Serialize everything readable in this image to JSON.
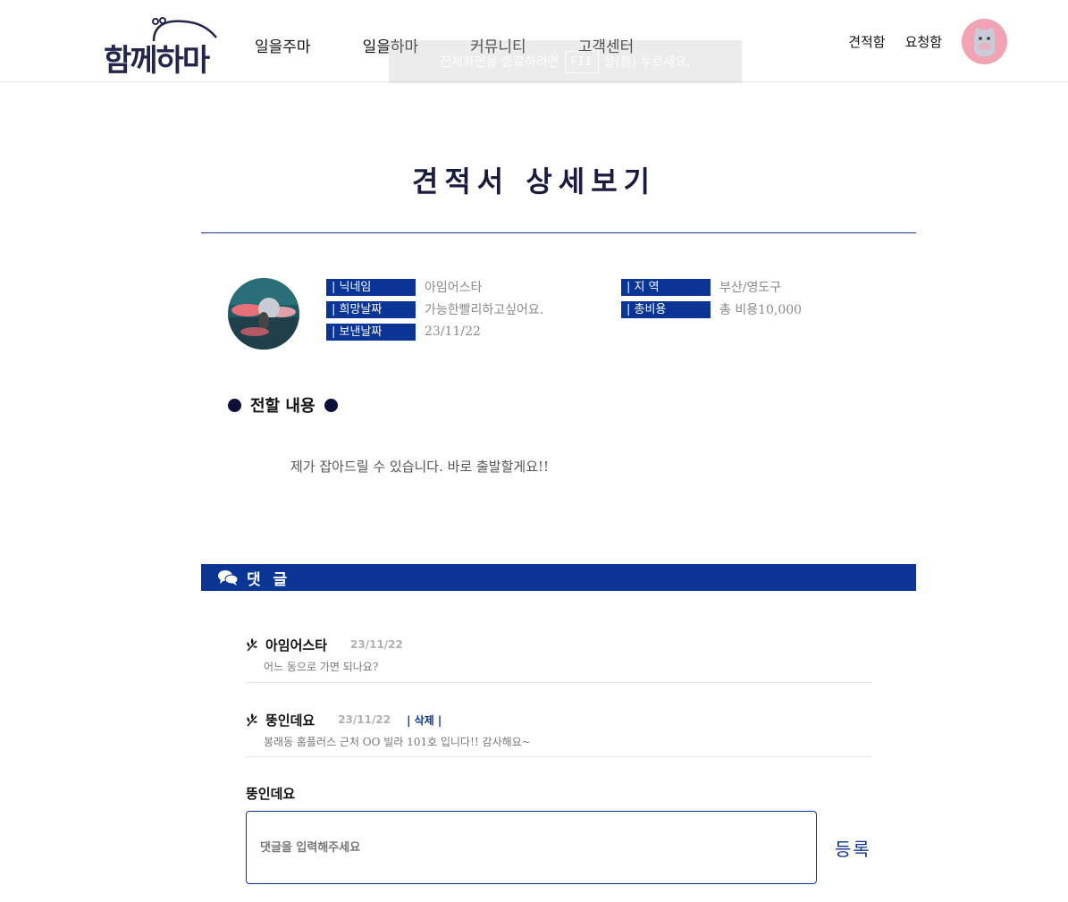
{
  "header": {
    "logo_text": "함께하마",
    "nav": [
      "일을주마",
      "일을하마",
      "커뮤니티",
      "고객센터"
    ],
    "links": {
      "quote_box": "견적함",
      "request_box": "요청함"
    },
    "fullscreen_hint": {
      "before": "전체화면을 종료하려면",
      "key": "F11",
      "after": "을(를) 누르세요."
    }
  },
  "page": {
    "title": "견적서 상세보기"
  },
  "info": {
    "nickname_label": "| 닉네임",
    "nickname": "아임어스타",
    "wish_date_label": "| 희망날짜",
    "wish_date": "가능한빨리하고싶어요.",
    "sent_date_label": "| 보낸날짜",
    "sent_date": "23/11/22",
    "region_label": "| 지  역",
    "region": "부산/영도구",
    "cost_label": "| 총비용",
    "cost": "총 비용10,000"
  },
  "message": {
    "heading": "전할 내용",
    "text": "제가 잡아드릴 수 있습니다. 바로 출발할게요!!"
  },
  "comments": {
    "bar_label": "댓 글",
    "items": [
      {
        "author": "아임어스타",
        "date": "23/11/22",
        "text": "어느 동으로 가면 되나요?"
      },
      {
        "author": "뚱인데요",
        "date": "23/11/22",
        "delete_label": "| 삭제 |",
        "text": "봉래동 홈플러스 근처 OO 빌라 101호 입니다!! 감사해요~"
      }
    ],
    "writer": "뚱인데요",
    "input_placeholder": "댓글을 입력해주세요",
    "submit_label": "등록"
  },
  "colors": {
    "primary": "#0a3595",
    "title": "#1a1b3f",
    "muted": "#8a8a8a"
  }
}
